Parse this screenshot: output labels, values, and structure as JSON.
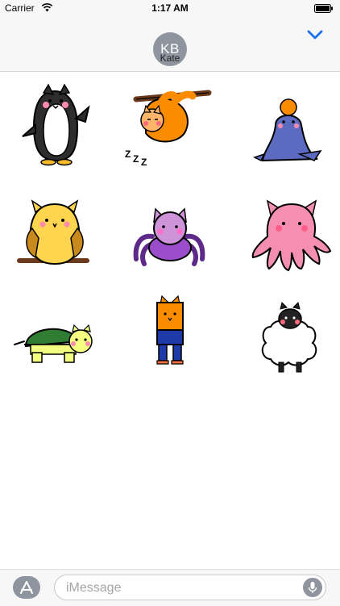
{
  "status_bar": {
    "carrier": "Carrier",
    "time": "1:17 AM"
  },
  "header": {
    "avatar_initials": "KB",
    "contact_name": "Kate"
  },
  "stickers": [
    {
      "name": "penguin"
    },
    {
      "name": "sloth"
    },
    {
      "name": "seal"
    },
    {
      "name": "owl"
    },
    {
      "name": "spider"
    },
    {
      "name": "octopus"
    },
    {
      "name": "turtle"
    },
    {
      "name": "orange-cat"
    },
    {
      "name": "sheep"
    }
  ],
  "input": {
    "placeholder": "iMessage"
  },
  "colors": {
    "accent": "#1a73e8",
    "gray": "#8e959f"
  }
}
